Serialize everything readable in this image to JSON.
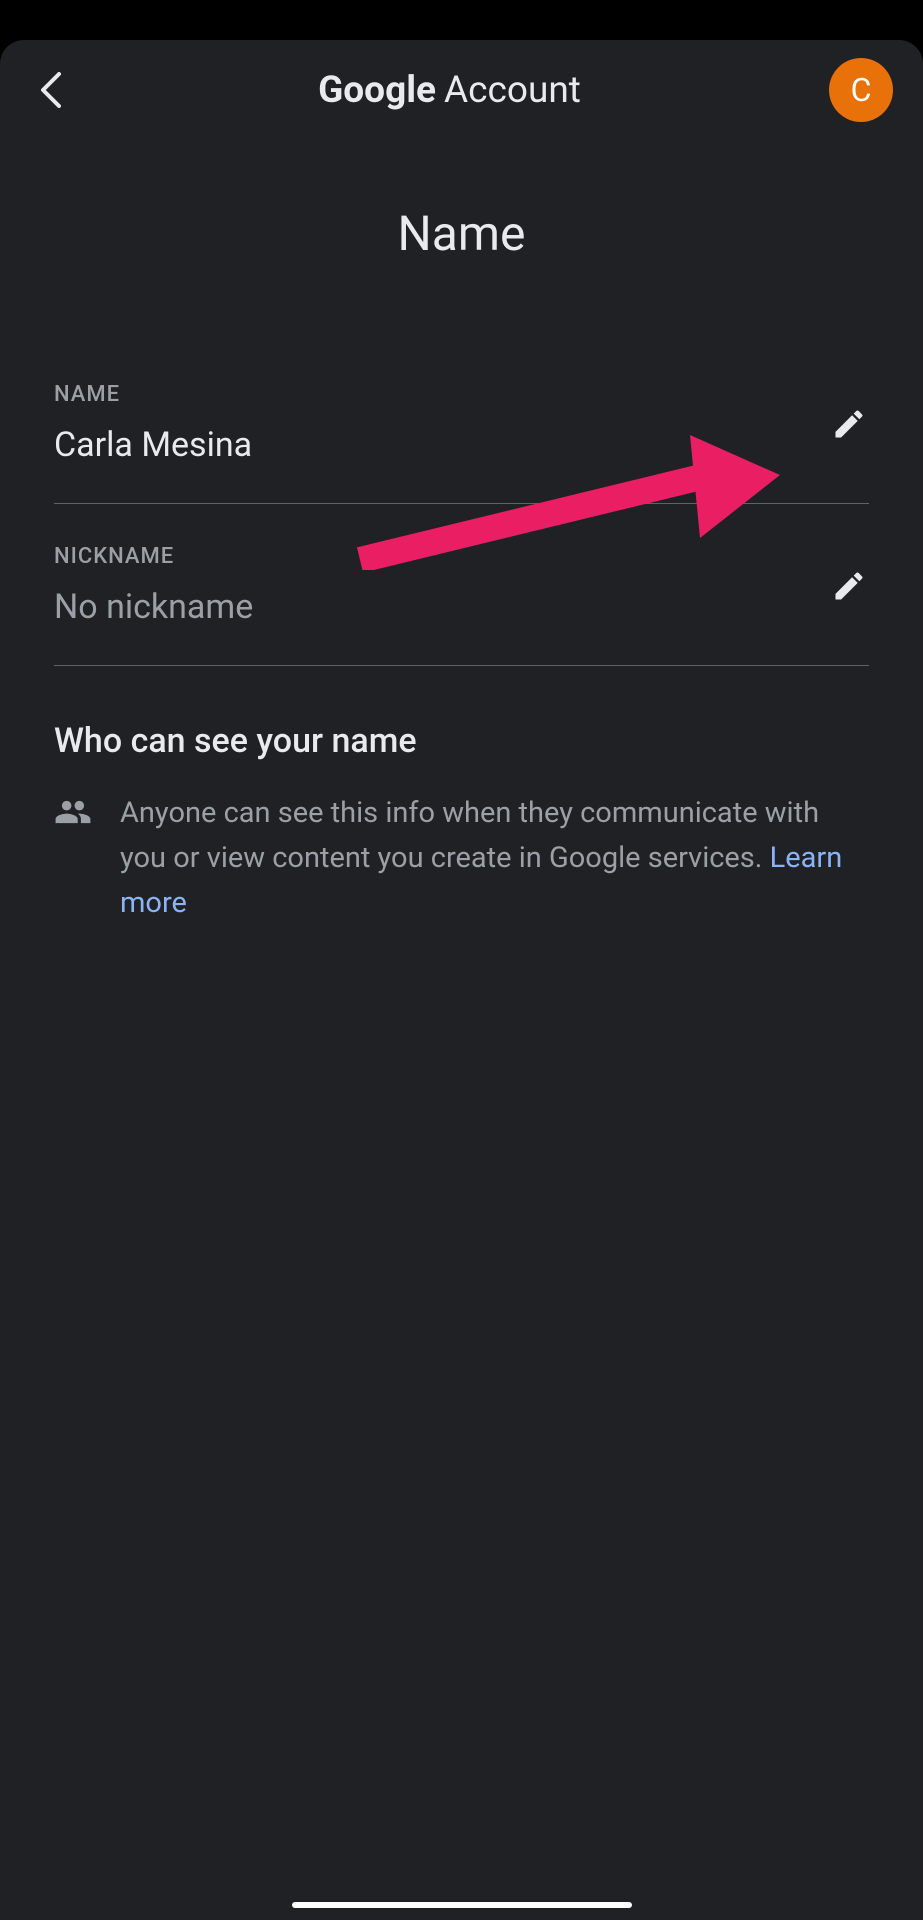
{
  "header": {
    "title_bold": "Google",
    "title_normal": "Account",
    "avatar_initial": "C"
  },
  "page": {
    "title": "Name"
  },
  "fields": {
    "name": {
      "label": "NAME",
      "value": "Carla Mesina"
    },
    "nickname": {
      "label": "NICKNAME",
      "value": "No nickname"
    }
  },
  "visibility": {
    "title": "Who can see your name",
    "info_prefix": "Anyone can see this info when they communicate with you or view content you create in Google ser­vices. ",
    "learn_more": "Learn more"
  }
}
